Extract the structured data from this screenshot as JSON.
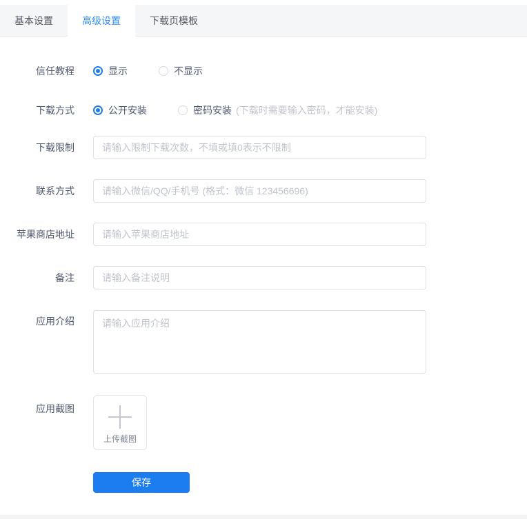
{
  "tabs": [
    {
      "label": "基本设置",
      "active": false
    },
    {
      "label": "高级设置",
      "active": true
    },
    {
      "label": "下载页模板",
      "active": false
    }
  ],
  "form": {
    "trust_tutorial": {
      "label": "信任教程",
      "options": [
        {
          "label": "显示",
          "selected": true
        },
        {
          "label": "不显示",
          "selected": false
        }
      ]
    },
    "download_method": {
      "label": "下载方式",
      "options": [
        {
          "label": "公开安装",
          "selected": true
        },
        {
          "label": "密码安装",
          "selected": false,
          "hint": "(下载时需要输入密码，才能安装)"
        }
      ]
    },
    "download_limit": {
      "label": "下载限制",
      "placeholder": "请输入限制下载次数，不填或填0表示不限制",
      "value": ""
    },
    "contact": {
      "label": "联系方式",
      "placeholder": "请输入微信/QQ/手机号 (格式：微信 123456696)",
      "value": ""
    },
    "apple_store_url": {
      "label": "苹果商店地址",
      "placeholder": "请输入苹果商店地址",
      "value": ""
    },
    "remark": {
      "label": "备注",
      "placeholder": "请输入备注说明",
      "value": ""
    },
    "app_intro": {
      "label": "应用介绍",
      "placeholder": "请输入应用介绍",
      "value": ""
    },
    "app_screenshot": {
      "label": "应用截图",
      "upload_text": "上传截图"
    }
  },
  "save_button": {
    "label": "保存"
  },
  "colors": {
    "primary_blue": "#1c7df1",
    "tab_active_blue": "#2d8cf0",
    "tabbar_background": "#f5f6f7",
    "border_gray": "#dcdfe6",
    "placeholder_gray": "#c0c4cc",
    "label_gray": "#515a6e"
  }
}
